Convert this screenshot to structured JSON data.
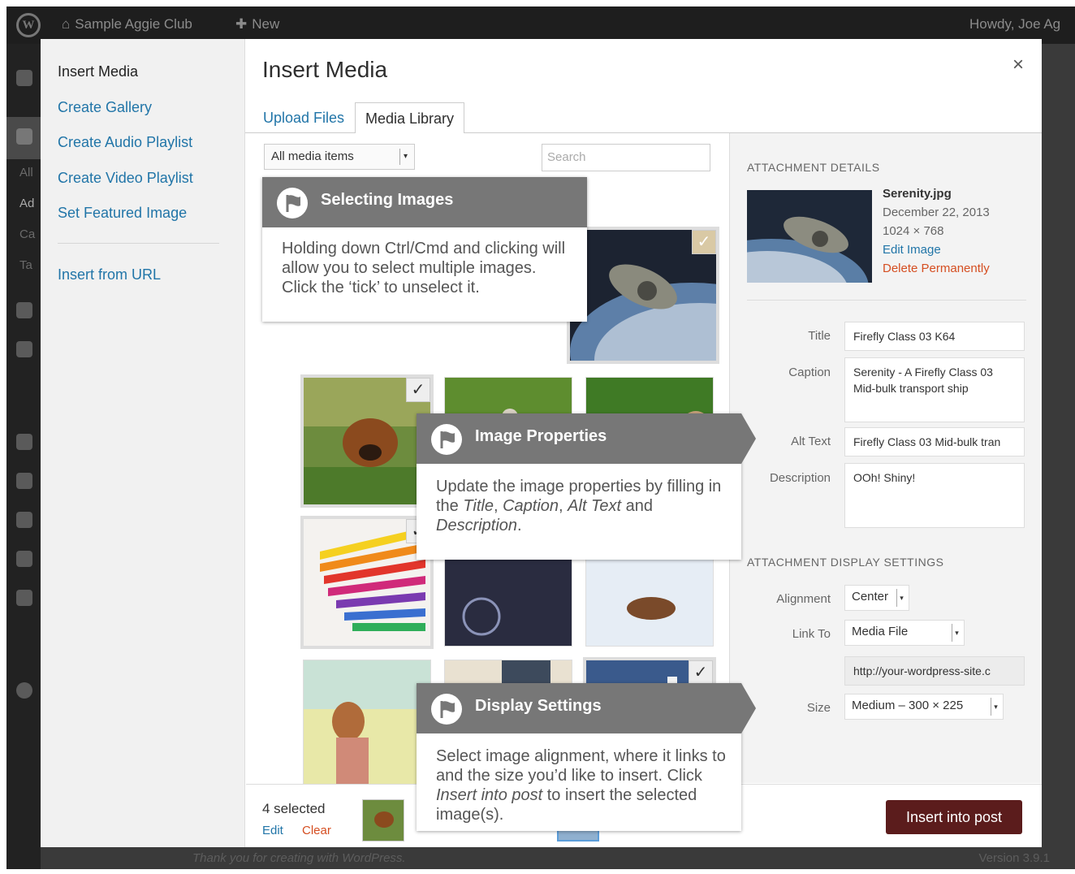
{
  "adminbar": {
    "site_name": "Sample Aggie Club",
    "new_label": "New",
    "howdy": "Howdy, Joe Ag",
    "logo_icon": "wordpress-logo-icon"
  },
  "sidebar_menu": {
    "partial_labels": [
      "All",
      "Ad",
      "Ca",
      "Ta"
    ]
  },
  "footer": {
    "thanks": "Thank you for creating with WordPress.",
    "version": "Version 3.9.1"
  },
  "modal": {
    "title": "Insert Media",
    "close": "×",
    "menu": {
      "heading": "Insert Media",
      "items": [
        "Create Gallery",
        "Create Audio Playlist",
        "Create Video Playlist",
        "Set Featured Image"
      ],
      "insert_from_url": "Insert from URL"
    },
    "tabs": [
      {
        "label": "Upload Files",
        "active": false
      },
      {
        "label": "Media Library",
        "active": true
      }
    ],
    "filter": {
      "value": "All media items"
    },
    "search": {
      "placeholder": "Search"
    },
    "thumbs": [
      {
        "name": "firefly-ship",
        "selected": true,
        "check": "✓"
      },
      {
        "name": "puppy-in-grass",
        "selected": true,
        "check": "✓"
      },
      {
        "name": "kitten-on-grass",
        "selected": false
      },
      {
        "name": "bulldog-puppies",
        "selected": false
      },
      {
        "name": "colored-pencils",
        "selected": true,
        "check": "✓"
      },
      {
        "name": "bicycle-dark",
        "selected": false
      },
      {
        "name": "dog-in-snow",
        "selected": false
      },
      {
        "name": "girl-headphones",
        "selected": false
      },
      {
        "name": "person-walking",
        "selected": false
      },
      {
        "name": "lighthouse",
        "selected": true,
        "check": "✓"
      }
    ],
    "details": {
      "heading": "ATTACHMENT DETAILS",
      "filename": "Serenity.jpg",
      "date": "December 22, 2013",
      "dimensions": "1024 × 768",
      "edit_image": "Edit Image",
      "delete": "Delete Permanently",
      "fields": {
        "title_label": "Title",
        "title_value": "Firefly Class 03 K64",
        "caption_label": "Caption",
        "caption_value": "Serenity - A Firefly Class 03 Mid-bulk transport ship",
        "alt_label": "Alt Text",
        "alt_value": "Firefly Class 03 Mid-bulk tran",
        "desc_label": "Description",
        "desc_value": "OOh! Shiny!"
      },
      "display_heading": "ATTACHMENT DISPLAY SETTINGS",
      "display": {
        "alignment_label": "Alignment",
        "alignment_value": "Center",
        "link_label": "Link To",
        "link_value": "Media File",
        "url_value": "http://your-wordpress-site.c",
        "size_label": "Size",
        "size_value": "Medium – 300 × 225"
      }
    },
    "toolbar": {
      "selected": "4 selected",
      "edit": "Edit",
      "clear": "Clear",
      "insert": "Insert into post"
    }
  },
  "callouts": {
    "selecting": {
      "title": "Selecting Images",
      "body": "Holding down Ctrl/Cmd and clicking will allow you to select multiple images. Click the ‘tick’ to unselect it."
    },
    "properties": {
      "title": "Image Properties",
      "body_pre": "Update the image properties by filling in the ",
      "body_title": "Title",
      "body_sep1": ", ",
      "body_caption": "Caption",
      "body_sep2": ", ",
      "body_alt": "Alt Text",
      "body_and": " and ",
      "body_desc": "Description",
      "body_end": "."
    },
    "display": {
      "title": "Display Settings",
      "body_pre": "Select image alignment, where it links to and the size you’d like to insert. Click ",
      "body_em": "Insert into post",
      "body_post": " to insert the selected image(s)."
    }
  },
  "colors": {
    "link": "#2175a8",
    "danger": "#d54e21",
    "insert_button": "#5b1c1c",
    "callout_header": "#777777"
  }
}
